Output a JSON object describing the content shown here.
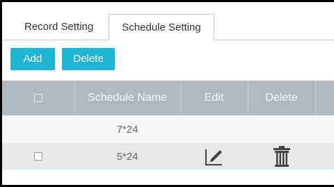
{
  "tabs": [
    {
      "label": "Record Setting",
      "active": false
    },
    {
      "label": "Schedule Setting",
      "active": true
    }
  ],
  "toolbar": {
    "add_label": "Add",
    "delete_label": "Delete",
    "button_color": "#1fb5d4"
  },
  "table": {
    "headers": {
      "schedule_name": "Schedule Name",
      "edit": "Edit",
      "delete": "Delete"
    },
    "rows": [
      {
        "schedule_name": "7*24",
        "checkbox": false,
        "edit_icon": "",
        "delete_icon": ""
      },
      {
        "schedule_name": "5*24",
        "checkbox": true,
        "edit_icon": "edit-icon",
        "delete_icon": "trash-icon"
      }
    ]
  },
  "colors": {
    "header_bg": "#aeb9c2",
    "row_light": "#f4f6f8",
    "row_alt": "#e4e9ee"
  }
}
